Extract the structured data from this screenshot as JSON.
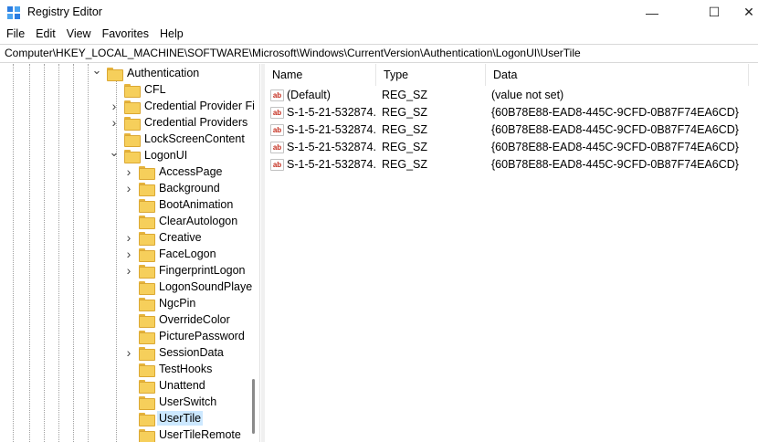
{
  "window": {
    "title": "Registry Editor",
    "controls": {
      "minimize": "—",
      "maximize": "☐",
      "close": "✕"
    }
  },
  "menu": [
    "File",
    "Edit",
    "View",
    "Favorites",
    "Help"
  ],
  "address": "Computer\\HKEY_LOCAL_MACHINE\\SOFTWARE\\Microsoft\\Windows\\CurrentVersion\\Authentication\\LogonUI\\UserTile",
  "tree": [
    {
      "label": "Authentication",
      "expander": "expanded",
      "depth": 0,
      "selected": false
    },
    {
      "label": "CFL",
      "expander": "none",
      "depth": 1,
      "selected": false
    },
    {
      "label": "Credential Provider Fi",
      "expander": "collapsed",
      "depth": 1,
      "selected": false
    },
    {
      "label": "Credential Providers",
      "expander": "collapsed",
      "depth": 1,
      "selected": false
    },
    {
      "label": "LockScreenContent",
      "expander": "none",
      "depth": 1,
      "selected": false
    },
    {
      "label": "LogonUI",
      "expander": "expanded",
      "depth": 1,
      "selected": false
    },
    {
      "label": "AccessPage",
      "expander": "collapsed",
      "depth": 2,
      "selected": false
    },
    {
      "label": "Background",
      "expander": "collapsed",
      "depth": 2,
      "selected": false
    },
    {
      "label": "BootAnimation",
      "expander": "none",
      "depth": 2,
      "selected": false
    },
    {
      "label": "ClearAutologon",
      "expander": "none",
      "depth": 2,
      "selected": false
    },
    {
      "label": "Creative",
      "expander": "collapsed",
      "depth": 2,
      "selected": false
    },
    {
      "label": "FaceLogon",
      "expander": "collapsed",
      "depth": 2,
      "selected": false
    },
    {
      "label": "FingerprintLogon",
      "expander": "collapsed",
      "depth": 2,
      "selected": false
    },
    {
      "label": "LogonSoundPlaye",
      "expander": "none",
      "depth": 2,
      "selected": false
    },
    {
      "label": "NgcPin",
      "expander": "none",
      "depth": 2,
      "selected": false
    },
    {
      "label": "OverrideColor",
      "expander": "none",
      "depth": 2,
      "selected": false
    },
    {
      "label": "PicturePassword",
      "expander": "none",
      "depth": 2,
      "selected": false
    },
    {
      "label": "SessionData",
      "expander": "collapsed",
      "depth": 2,
      "selected": false
    },
    {
      "label": "TestHooks",
      "expander": "none",
      "depth": 2,
      "selected": false
    },
    {
      "label": "Unattend",
      "expander": "none",
      "depth": 2,
      "selected": false
    },
    {
      "label": "UserSwitch",
      "expander": "none",
      "depth": 2,
      "selected": false
    },
    {
      "label": "UserTile",
      "expander": "none",
      "depth": 2,
      "selected": true
    },
    {
      "label": "UserTileRemote",
      "expander": "none",
      "depth": 2,
      "selected": false
    }
  ],
  "values": {
    "headers": {
      "name": "Name",
      "type": "Type",
      "data": "Data"
    },
    "rows": [
      {
        "icon": "ab-string-icon",
        "icon_text": "ab",
        "name": "(Default)",
        "type": "REG_SZ",
        "data": "(value not set)"
      },
      {
        "icon": "ab-string-icon",
        "icon_text": "ab",
        "name": "S-1-5-21-532874...",
        "type": "REG_SZ",
        "data": "{60B78E88-EAD8-445C-9CFD-0B87F74EA6CD}"
      },
      {
        "icon": "ab-string-icon",
        "icon_text": "ab",
        "name": "S-1-5-21-532874...",
        "type": "REG_SZ",
        "data": "{60B78E88-EAD8-445C-9CFD-0B87F74EA6CD}"
      },
      {
        "icon": "ab-string-icon",
        "icon_text": "ab",
        "name": "S-1-5-21-532874...",
        "type": "REG_SZ",
        "data": "{60B78E88-EAD8-445C-9CFD-0B87F74EA6CD}"
      },
      {
        "icon": "ab-string-icon",
        "icon_text": "ab",
        "name": "S-1-5-21-532874...",
        "type": "REG_SZ",
        "data": "{60B78E88-EAD8-445C-9CFD-0B87F74EA6CD}"
      }
    ]
  },
  "colors": {
    "selection": "#cce8ff",
    "folder": "#f6cf5b",
    "string_icon": "#c42b1c"
  }
}
